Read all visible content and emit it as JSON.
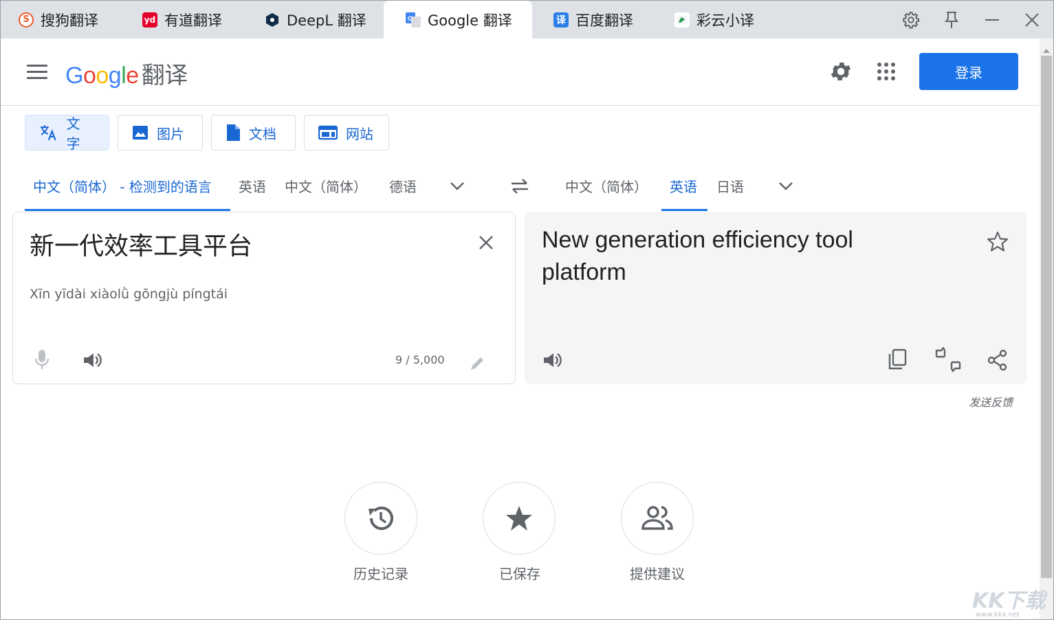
{
  "tabs": [
    {
      "label": "搜狗翻译",
      "icon": "sogou-icon"
    },
    {
      "label": "有道翻译",
      "icon": "youdao-icon"
    },
    {
      "label": "DeepL 翻译",
      "icon": "deepl-icon"
    },
    {
      "label": "Google 翻译",
      "icon": "google-translate-icon",
      "active": true
    },
    {
      "label": "百度翻译",
      "icon": "baidu-icon"
    },
    {
      "label": "彩云小译",
      "icon": "caiyun-icon"
    }
  ],
  "header": {
    "logo": "Google",
    "logo_suffix": "翻译",
    "login_label": "登录"
  },
  "modes": [
    {
      "label": "文字",
      "selected": true
    },
    {
      "label": "图片"
    },
    {
      "label": "文档"
    },
    {
      "label": "网站"
    }
  ],
  "source_langs": {
    "detected": "中文（简体） - 检测到的语言",
    "opt1": "英语",
    "opt2": "中文（简体）",
    "opt3": "德语"
  },
  "target_langs": {
    "opt1": "中文（简体）",
    "opt2": "英语",
    "opt3": "日语"
  },
  "source": {
    "text": "新一代效率工具平台",
    "pinyin": "Xīn yīdài xiàolǜ gōngjù píngtái",
    "char_count": "9 / 5,000"
  },
  "target": {
    "text": "New generation efficiency tool platform"
  },
  "feedback_label": "发送反馈",
  "bottom": {
    "history": "历史记录",
    "saved": "已保存",
    "contribute": "提供建议"
  },
  "watermark": {
    "brand": "KK下载",
    "site": "www.kkx.net"
  },
  "colors": {
    "accent": "#1a73e8",
    "tab_bg": "#dee1e6",
    "target_bg": "#f5f5f5"
  }
}
